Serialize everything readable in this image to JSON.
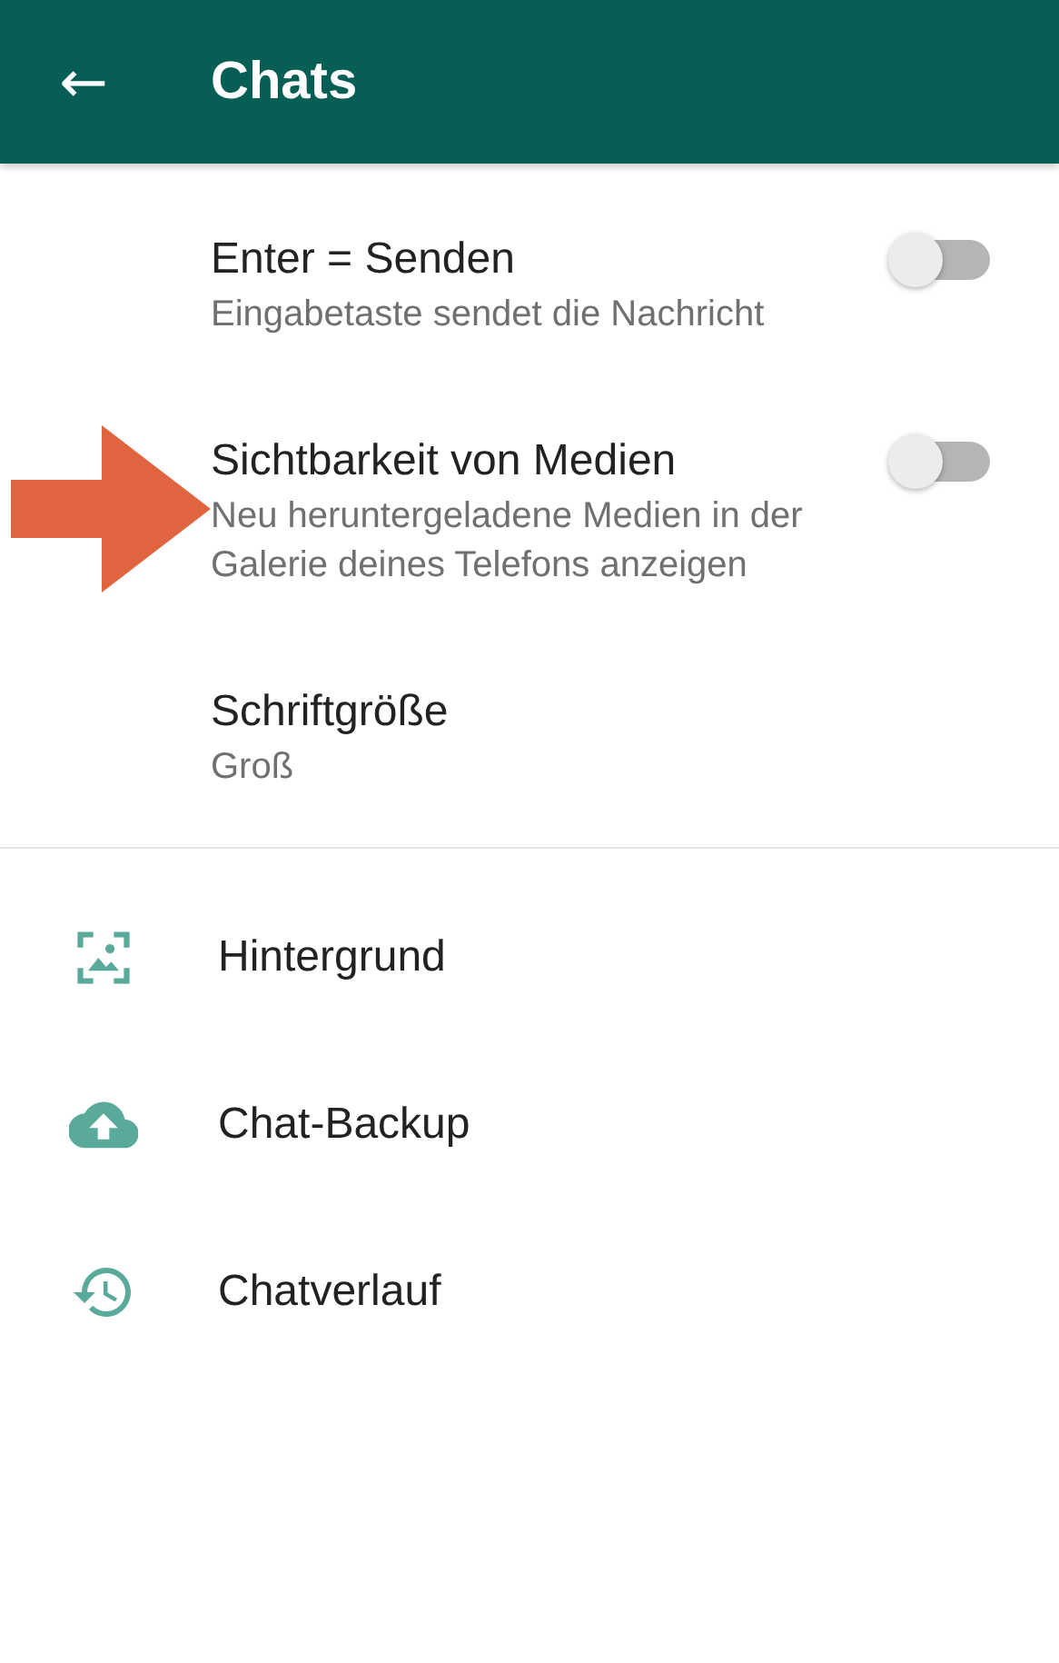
{
  "header": {
    "back_icon": "←",
    "title": "Chats"
  },
  "settings": [
    {
      "kind": "toggle",
      "title": "Enter = Senden",
      "subtitle": [
        "Eingabetaste sendet die Nachricht"
      ],
      "on": false,
      "highlighted": false
    },
    {
      "kind": "toggle",
      "title": "Sichtbarkeit von Medien",
      "subtitle": [
        "Neu heruntergeladene Medien in der",
        "Galerie deines Telefons anzeigen"
      ],
      "on": false,
      "highlighted": true
    },
    {
      "kind": "value",
      "title": "Schriftgröße",
      "subtitle": [
        "Groß"
      ]
    }
  ],
  "links": [
    {
      "kind": "wallpaper",
      "label": "Hintergrund"
    },
    {
      "kind": "backup",
      "label": "Chat-Backup"
    },
    {
      "kind": "history",
      "label": "Chatverlauf"
    }
  ]
}
